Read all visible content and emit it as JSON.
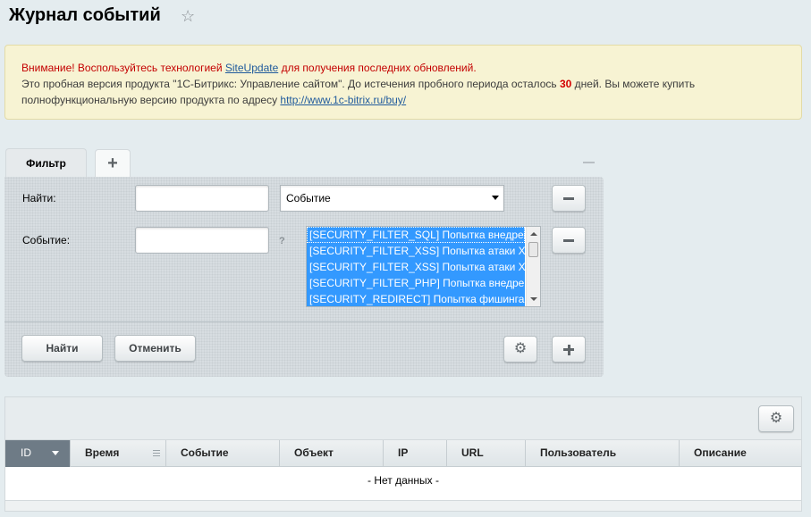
{
  "page": {
    "title": "Журнал событий"
  },
  "notice": {
    "warning_prefix": "Внимание! Воспользуйтесь технологией ",
    "warning_link": "SiteUpdate",
    "warning_suffix": " для получения последних обновлений.",
    "trial_text_1": "Это пробная версия продукта \"1С-Битрикс: Управление сайтом\". До истечения пробного периода осталось ",
    "trial_days": "30",
    "trial_text_2": " дней. Вы можете купить полнофункциональную версию продукта по адресу ",
    "buy_link": "http://www.1c-bitrix.ru/buy/"
  },
  "filter": {
    "tab_label": "Фильтр",
    "add_tab_label": "+",
    "find_label": "Найти:",
    "find_value": "",
    "find_select_value": "Событие",
    "event_label": "Событие:",
    "event_value": "",
    "help_mark": "?",
    "event_options": [
      "[SECURITY_FILTER_SQL] Попытка внедрения SQL",
      "[SECURITY_FILTER_XSS] Попытка атаки XSS",
      "[SECURITY_FILTER_XSS] Попытка атаки XSS",
      "[SECURITY_FILTER_PHP] Попытка внедрения PHP",
      "[SECURITY_REDIRECT] Попытка фишинга"
    ],
    "find_button": "Найти",
    "cancel_button": "Отменить"
  },
  "grid": {
    "columns": [
      "ID",
      "Время",
      "Событие",
      "Объект",
      "IP",
      "URL",
      "Пользователь",
      "Описание"
    ],
    "empty_text": "- Нет данных -"
  },
  "colors": {
    "warning": "#c40000",
    "link": "#1f5a9c",
    "selection": "#3399ff",
    "sorted_column": "#6e7b86"
  }
}
